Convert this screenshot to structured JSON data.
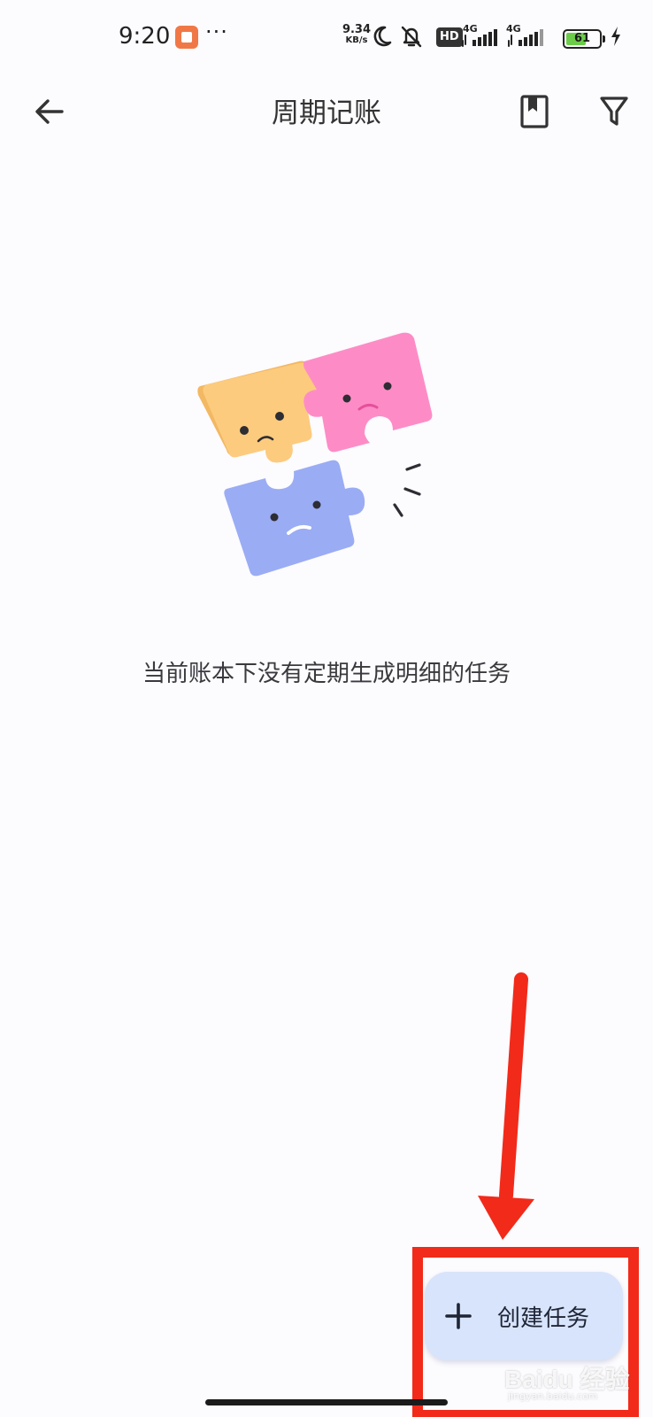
{
  "status_bar": {
    "time": "9:20",
    "app_notification_icon": "app-notification-icon",
    "more_indicator": "···",
    "net_speed_value": "9.34",
    "net_speed_unit": "KB/s",
    "hd_badge": "HD",
    "signal_1_label": "4G",
    "signal_2_label": "4G",
    "battery_level": "61",
    "icons": [
      "moon-icon",
      "bell-off-icon",
      "signal-icon",
      "signal-icon",
      "battery-icon",
      "charging-bolt-icon"
    ]
  },
  "app_bar": {
    "title": "周期记账",
    "back_icon": "arrow-left-icon",
    "actions": [
      "book-icon",
      "filter-icon"
    ]
  },
  "empty_state": {
    "illustration": "sad-puzzle-pieces-illustration",
    "message": "当前账本下没有定期生成明细的任务"
  },
  "fab": {
    "icon": "plus-icon",
    "label": "创建任务"
  },
  "annotation": {
    "color": "#f22a1a",
    "type": "red-arrow-and-box"
  },
  "watermark": {
    "logo_text": "Baidu 经验",
    "site": "jingyan.baidu.com"
  },
  "colors": {
    "background": "#fcfbfe",
    "fab_background": "#d8e4fb",
    "puzzle_yellow": "#fccb7e",
    "puzzle_pink": "#fd8cc6",
    "puzzle_blue": "#9aacf4"
  }
}
